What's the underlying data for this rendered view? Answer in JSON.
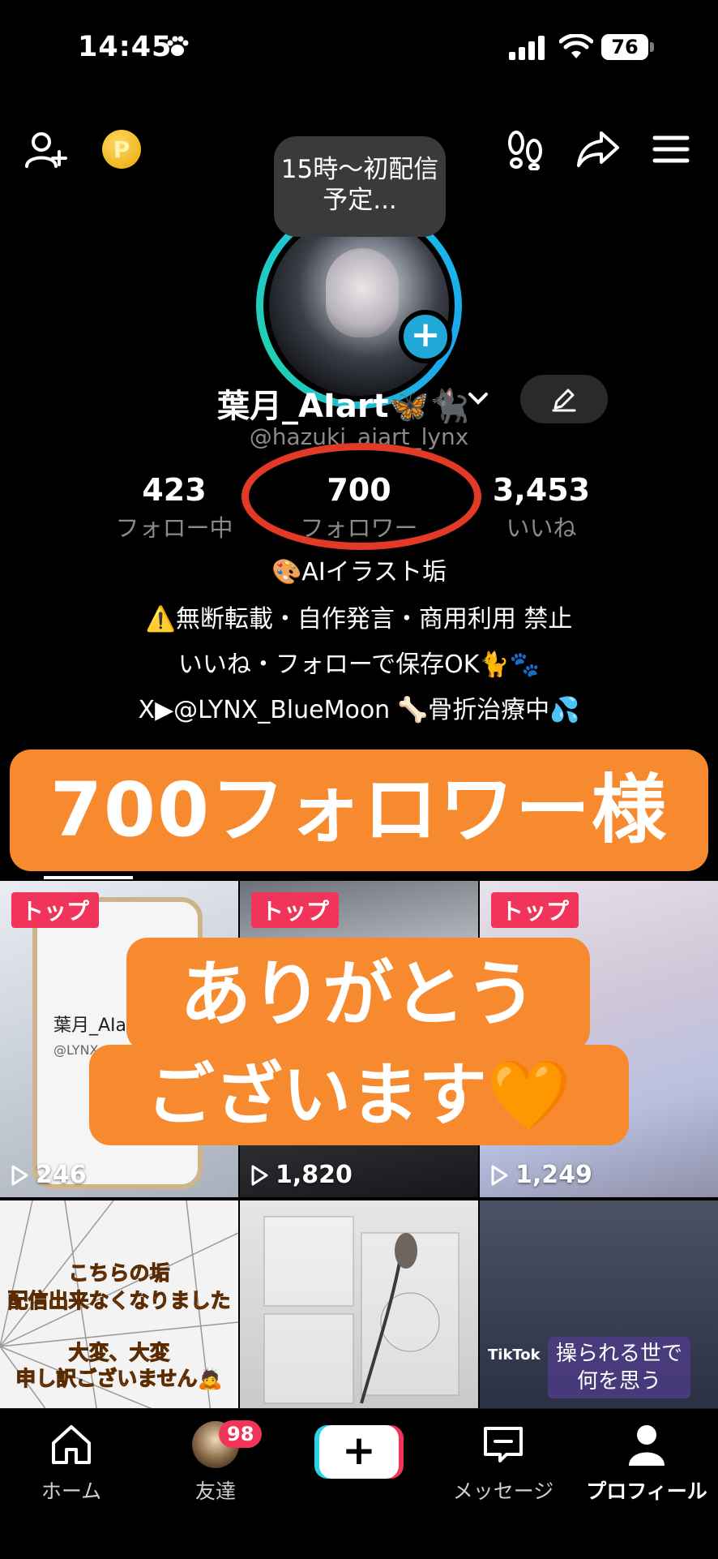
{
  "status_bar": {
    "time": "14:45",
    "battery": "76"
  },
  "profile": {
    "note": "15時～初配信予定...",
    "display_name": "葉月_AIart🦋🐈‍⬛",
    "handle": "@hazuki_aiart_lynx",
    "stats": {
      "following": {
        "value": "423",
        "label": "フォロー中"
      },
      "followers": {
        "value": "700",
        "label": "フォロワー"
      },
      "likes": {
        "value": "3,453",
        "label": "いいね"
      }
    },
    "bio": [
      "🎨AIイラスト垢",
      "⚠️無断転載・自作発言・商用利用  禁止",
      "いいね・フォローで保存OK🐈🐾",
      "X▶@LYNX_BlueMoon  🦴骨折治療中💦"
    ]
  },
  "overlay": {
    "banner_top": "700フォロワー様",
    "banner_line1": "ありがとう",
    "banner_line2": "ございます🧡"
  },
  "videos": [
    {
      "badge": "トップ",
      "views": "246",
      "mock_name": "葉月_AIart",
      "mock_handle": "@LYNX_BlueMoon"
    },
    {
      "badge": "トップ",
      "views": "1,820"
    },
    {
      "badge": "トップ",
      "views": "1,249"
    },
    {
      "lines": [
        "こちらの垢",
        "配信出来なくなりました",
        "大変、大変",
        "申し訳ございません🙇"
      ]
    },
    {},
    {
      "caption_line1": "操られる世で",
      "caption_line2": "何を思う",
      "watermark": "TikTok"
    }
  ],
  "bottom_nav": {
    "home": "ホーム",
    "friends": "友達",
    "friends_badge": "98",
    "inbox": "メッセージ",
    "profile": "プロフィール"
  }
}
